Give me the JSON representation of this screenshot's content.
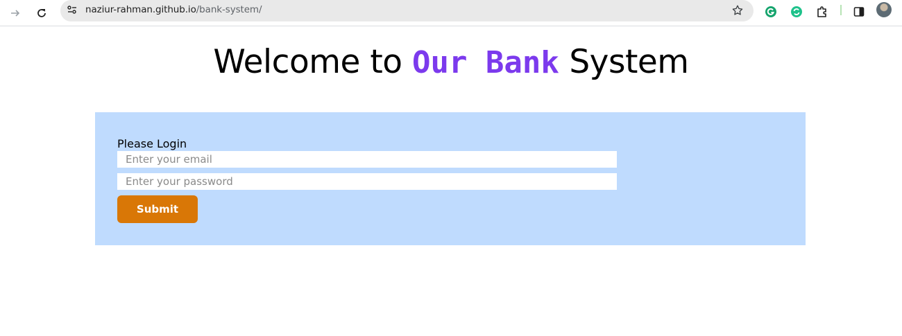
{
  "browser": {
    "url_host": "naziur-rahman.github.io",
    "url_path": "/bank-system/",
    "icons": [
      "forward-icon",
      "reload-icon",
      "site-settings-icon",
      "bookmark-star-icon",
      "grammarly-icon",
      "sync-extension-icon",
      "extensions-puzzle-icon",
      "side-panel-icon",
      "profile-avatar"
    ]
  },
  "header": {
    "prefix": "Welcome to ",
    "brand": "Our Bank",
    "suffix": " System",
    "brand_color": "#7c3aed"
  },
  "login": {
    "heading": "Please Login",
    "email_placeholder": "Enter your email",
    "password_placeholder": "Enter your password",
    "submit_label": "Submit",
    "panel_color": "#bfdbfe",
    "button_color": "#d97706"
  }
}
